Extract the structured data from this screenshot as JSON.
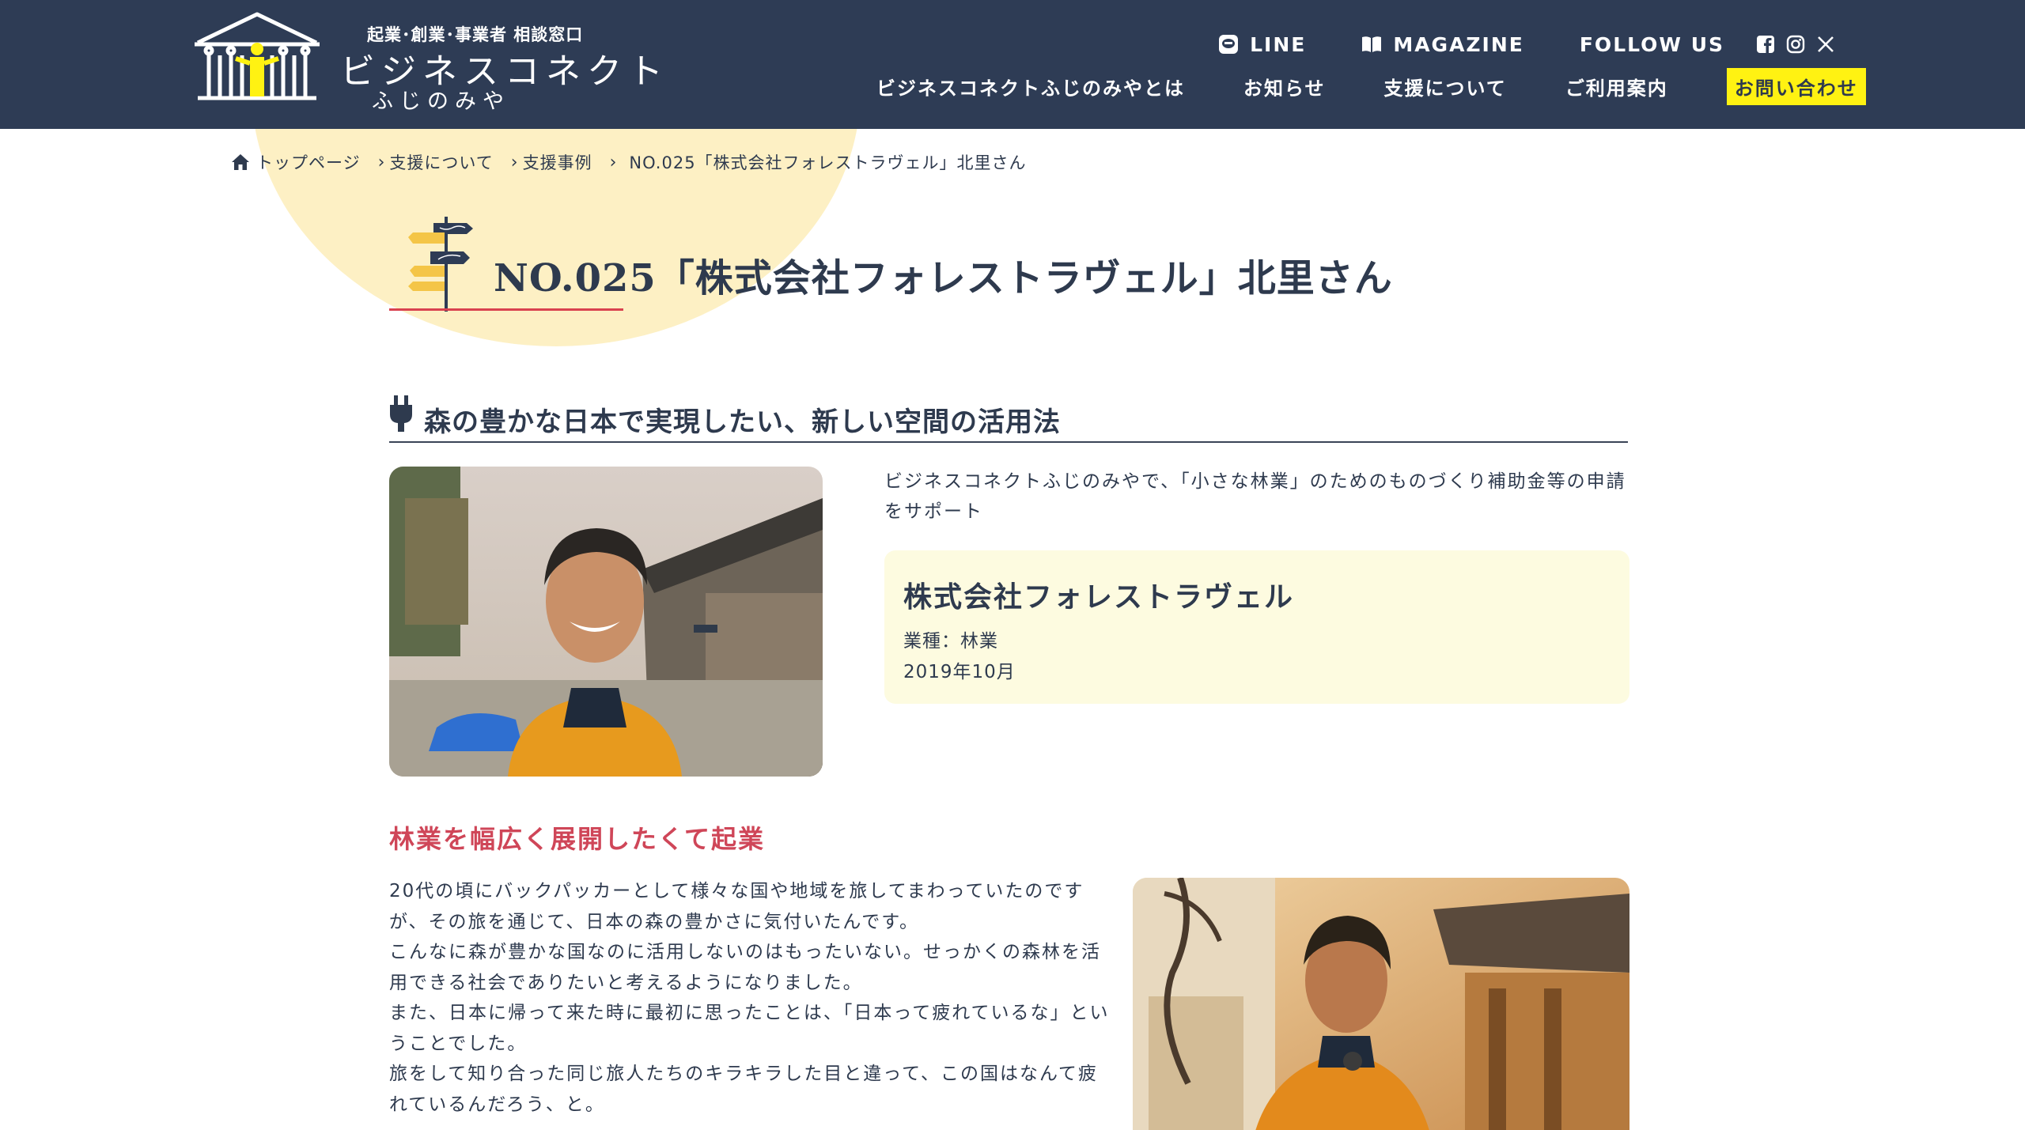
{
  "header": {
    "logo": {
      "tagline": "起業･創業･事業者 相談窓口",
      "name": "ビジネスコネクト",
      "sub": "ふじのみや"
    },
    "top_links": {
      "line": "LINE",
      "magazine": "MAGAZINE",
      "follow": "FOLLOW US"
    },
    "social": [
      "facebook-icon",
      "instagram-icon",
      "x-icon"
    ],
    "nav": {
      "about": "ビジネスコネクトふじのみやとは",
      "news": "お知らせ",
      "support": "支援について",
      "guide": "ご利用案内",
      "contact": "お問い合わせ"
    },
    "colors": {
      "header_bg": "#2e3c55",
      "contact_bg": "#fff212"
    }
  },
  "breadcrumb": {
    "home": "トップページ",
    "support": "支援について",
    "cases": "支援事例",
    "current": "NO.025「株式会社フォレストラヴェル」北里さん"
  },
  "page": {
    "title": "NO.025「株式会社フォレストラヴェル」北里さん",
    "section_title": "森の豊かな日本で実現したい、新しい空間の活用法",
    "intro": "ビジネスコネクトふじのみやで、「小さな林業」のためのものづくり補助金等の申請をサポート",
    "company": {
      "name": "株式会社フォレストラヴェル",
      "industry": "業種：林業",
      "date": "2019年10月"
    },
    "sub_heading": "林業を幅広く展開したくて起業",
    "story": [
      "20代の頃にバックパッカーとして様々な国や地域を旅してまわっていたのですが、その旅を通じて、日本の森の豊かさに気付いたんです。",
      "こんなに森が豊かな国なのに活用しないのはもったいない。せっかくの森林を活用できる社会でありたいと考えるようになりました。",
      "また、日本に帰って来た時に最初に思ったことは、「日本って疲れているな」ということでした。",
      "旅をして知り合った同じ旅人たちのキラキラした目と違って、この国はなんて疲れているんだろう、と。"
    ],
    "colors": {
      "accent_red": "#cf4658",
      "card_bg": "#fdfbe0",
      "deco_yellow": "#fdf0c4"
    }
  }
}
